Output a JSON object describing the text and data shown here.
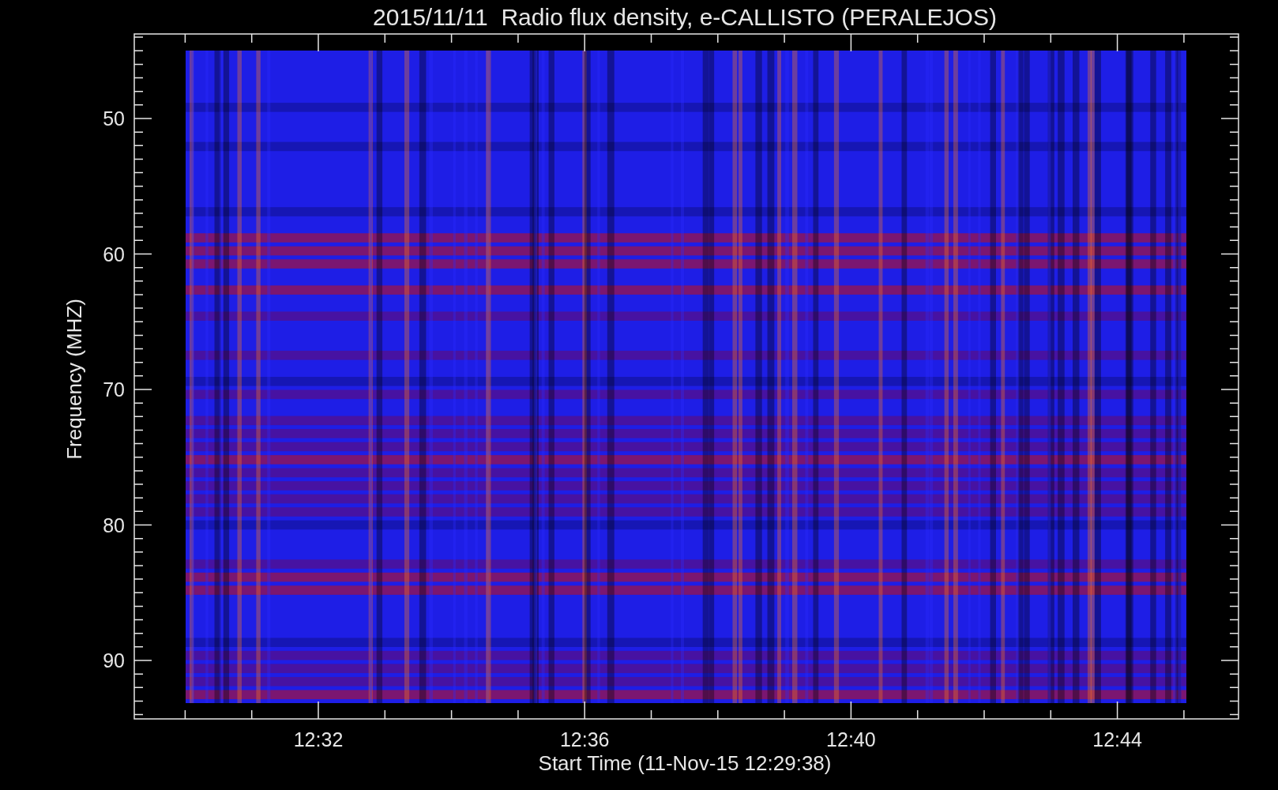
{
  "title": "2015/11/11  Radio flux density, e-CALLISTO (PERALEJOS)",
  "y_axis": {
    "label": "Frequency (MHZ)",
    "ticks": [
      "50",
      "60",
      "70",
      "80",
      "90"
    ]
  },
  "x_axis": {
    "label": "Start Time (11-Nov-15 12:29:38)",
    "ticks": [
      "12:32",
      "12:36",
      "12:40",
      "12:44"
    ]
  }
}
